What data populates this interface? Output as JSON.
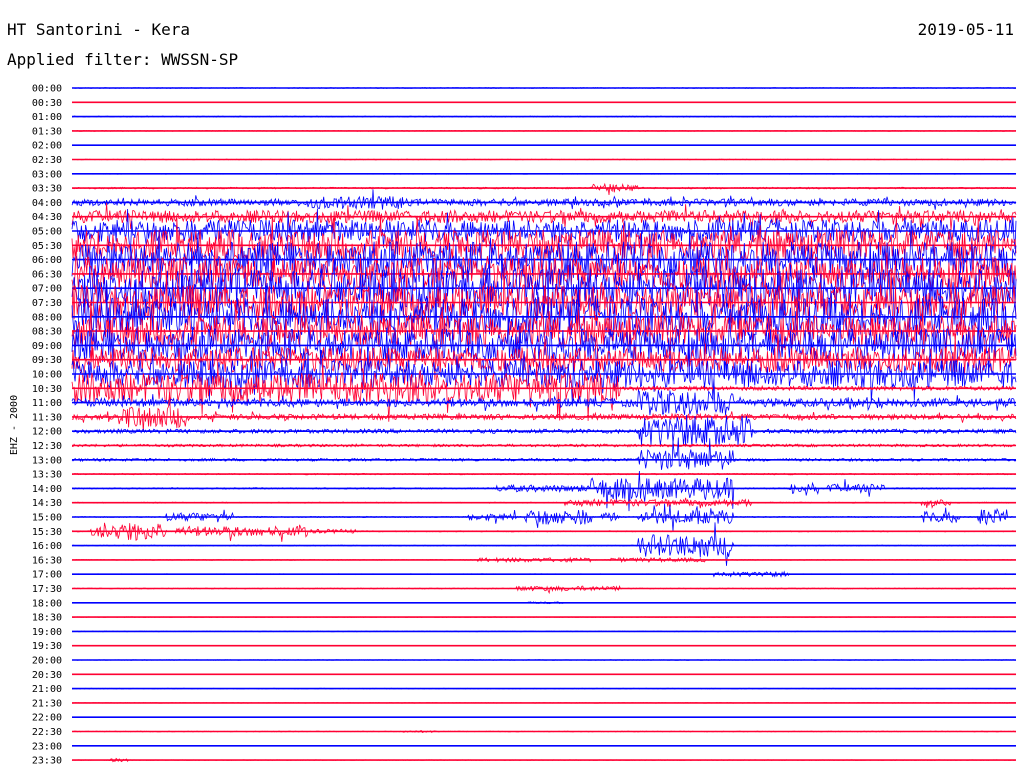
{
  "header": {
    "station": "HT Santorini - Kera",
    "date": "2019-05-11",
    "filter": "Applied filter: WWSSN-SP"
  },
  "chart_data": {
    "type": "line",
    "ylabel": "EHZ - 2000",
    "colors": [
      "#0000ff",
      "#ff0033"
    ],
    "grid": false,
    "legend": "none",
    "x_range_minutes": [
      0,
      30
    ],
    "rows": [
      {
        "label": "00:00",
        "color": "#0000ff",
        "activity": [
          [
            0,
            1.0,
            0.06
          ]
        ]
      },
      {
        "label": "00:30",
        "color": "#ff0033",
        "activity": [
          [
            0,
            1.0,
            0.05
          ]
        ]
      },
      {
        "label": "01:00",
        "color": "#0000ff",
        "activity": [
          [
            0,
            1.0,
            0.07
          ]
        ]
      },
      {
        "label": "01:30",
        "color": "#ff0033",
        "activity": [
          [
            0,
            1.0,
            0.06
          ]
        ]
      },
      {
        "label": "02:00",
        "color": "#0000ff",
        "activity": [
          [
            0,
            1.0,
            0.05
          ]
        ]
      },
      {
        "label": "02:30",
        "color": "#ff0033",
        "activity": [
          [
            0,
            1.0,
            0.04
          ]
        ]
      },
      {
        "label": "03:00",
        "color": "#0000ff",
        "activity": [
          [
            0,
            1.0,
            0.06
          ]
        ]
      },
      {
        "label": "03:30",
        "color": "#ff0033",
        "activity": [
          [
            0,
            1.0,
            0.12
          ],
          [
            0.55,
            0.6,
            0.6
          ]
        ]
      },
      {
        "label": "04:00",
        "color": "#0000ff",
        "activity": [
          [
            0,
            1.0,
            0.5
          ],
          [
            0.25,
            0.35,
            0.9
          ]
        ]
      },
      {
        "label": "04:30",
        "color": "#ff0033",
        "activity": [
          [
            0,
            1.0,
            0.9
          ]
        ]
      },
      {
        "label": "05:00",
        "color": "#0000ff",
        "activity": [
          [
            0,
            1.0,
            1.6
          ]
        ]
      },
      {
        "label": "05:30",
        "color": "#ff0033",
        "activity": [
          [
            0,
            1.0,
            2.2
          ]
        ]
      },
      {
        "label": "06:00",
        "color": "#0000ff",
        "activity": [
          [
            0,
            1.0,
            2.6
          ]
        ]
      },
      {
        "label": "06:30",
        "color": "#ff0033",
        "activity": [
          [
            0,
            1.0,
            2.4
          ]
        ]
      },
      {
        "label": "07:00",
        "color": "#0000ff",
        "activity": [
          [
            0,
            1.0,
            2.8
          ]
        ]
      },
      {
        "label": "07:30",
        "color": "#ff0033",
        "activity": [
          [
            0,
            1.0,
            2.5
          ]
        ]
      },
      {
        "label": "08:00",
        "color": "#0000ff",
        "activity": [
          [
            0,
            1.0,
            2.7
          ]
        ]
      },
      {
        "label": "08:30",
        "color": "#ff0033",
        "activity": [
          [
            0,
            1.0,
            2.3
          ]
        ]
      },
      {
        "label": "09:00",
        "color": "#0000ff",
        "activity": [
          [
            0,
            1.0,
            2.4
          ]
        ]
      },
      {
        "label": "09:30",
        "color": "#ff0033",
        "activity": [
          [
            0,
            1.0,
            1.8
          ]
        ]
      },
      {
        "label": "10:00",
        "color": "#0000ff",
        "activity": [
          [
            0,
            1.0,
            2.0
          ]
        ]
      },
      {
        "label": "10:30",
        "color": "#ff0033",
        "activity": [
          [
            0,
            0.58,
            2.2
          ],
          [
            0.58,
            1.0,
            0.3
          ]
        ]
      },
      {
        "label": "11:00",
        "color": "#0000ff",
        "activity": [
          [
            0,
            1.0,
            0.6
          ],
          [
            0.6,
            0.7,
            1.8
          ],
          [
            0.83,
            0.88,
            0.8
          ]
        ]
      },
      {
        "label": "11:30",
        "color": "#ff0033",
        "activity": [
          [
            0,
            1.0,
            0.4
          ],
          [
            0.05,
            0.12,
            1.6
          ]
        ]
      },
      {
        "label": "12:00",
        "color": "#0000ff",
        "activity": [
          [
            0,
            1.0,
            0.3
          ],
          [
            0.6,
            0.72,
            2.2
          ]
        ]
      },
      {
        "label": "12:30",
        "color": "#ff0033",
        "activity": [
          [
            0,
            1.0,
            0.2
          ]
        ]
      },
      {
        "label": "13:00",
        "color": "#0000ff",
        "activity": [
          [
            0,
            1.0,
            0.2
          ],
          [
            0.6,
            0.7,
            1.5
          ]
        ]
      },
      {
        "label": "13:30",
        "color": "#ff0033",
        "activity": [
          [
            0,
            1.0,
            0.1
          ]
        ]
      },
      {
        "label": "14:00",
        "color": "#0000ff",
        "activity": [
          [
            0,
            1.0,
            0.1
          ],
          [
            0.45,
            0.55,
            0.5
          ],
          [
            0.55,
            0.7,
            1.5
          ],
          [
            0.76,
            0.79,
            0.8
          ],
          [
            0.8,
            0.86,
            0.6
          ]
        ]
      },
      {
        "label": "14:30",
        "color": "#ff0033",
        "activity": [
          [
            0,
            1.0,
            0.08
          ],
          [
            0.52,
            0.72,
            0.5
          ],
          [
            0.9,
            0.93,
            0.4
          ]
        ]
      },
      {
        "label": "15:00",
        "color": "#0000ff",
        "activity": [
          [
            0,
            1.0,
            0.08
          ],
          [
            0.1,
            0.17,
            0.6
          ],
          [
            0.42,
            0.47,
            0.5
          ],
          [
            0.48,
            0.55,
            1.1
          ],
          [
            0.56,
            0.58,
            0.6
          ],
          [
            0.6,
            0.7,
            1.0
          ],
          [
            0.9,
            0.94,
            0.8
          ],
          [
            0.96,
            0.99,
            1.2
          ]
        ]
      },
      {
        "label": "15:30",
        "color": "#ff0033",
        "activity": [
          [
            0,
            1.0,
            0.08
          ],
          [
            0.02,
            0.1,
            1.3
          ],
          [
            0.11,
            0.25,
            0.7
          ],
          [
            0.25,
            0.3,
            0.3
          ]
        ]
      },
      {
        "label": "16:00",
        "color": "#0000ff",
        "activity": [
          [
            0,
            1.0,
            0.06
          ],
          [
            0.6,
            0.7,
            1.6
          ]
        ]
      },
      {
        "label": "16:30",
        "color": "#ff0033",
        "activity": [
          [
            0,
            1.0,
            0.06
          ],
          [
            0.43,
            0.55,
            0.3
          ],
          [
            0.57,
            0.67,
            0.3
          ]
        ]
      },
      {
        "label": "17:00",
        "color": "#0000ff",
        "activity": [
          [
            0,
            1.0,
            0.06
          ],
          [
            0.68,
            0.76,
            0.35
          ]
        ]
      },
      {
        "label": "17:30",
        "color": "#ff0033",
        "activity": [
          [
            0,
            1.0,
            0.06
          ],
          [
            0.47,
            0.58,
            0.35
          ]
        ]
      },
      {
        "label": "18:00",
        "color": "#0000ff",
        "activity": [
          [
            0,
            1.0,
            0.05
          ],
          [
            0.48,
            0.52,
            0.15
          ]
        ]
      },
      {
        "label": "18:30",
        "color": "#ff0033",
        "activity": [
          [
            0,
            1.0,
            0.05
          ]
        ]
      },
      {
        "label": "19:00",
        "color": "#0000ff",
        "activity": [
          [
            0,
            1.0,
            0.05
          ]
        ]
      },
      {
        "label": "19:30",
        "color": "#ff0033",
        "activity": [
          [
            0,
            1.0,
            0.05
          ]
        ]
      },
      {
        "label": "20:00",
        "color": "#0000ff",
        "activity": [
          [
            0,
            1.0,
            0.05
          ]
        ]
      },
      {
        "label": "20:30",
        "color": "#ff0033",
        "activity": [
          [
            0,
            1.0,
            0.05
          ]
        ]
      },
      {
        "label": "21:00",
        "color": "#0000ff",
        "activity": [
          [
            0,
            1.0,
            0.05
          ]
        ]
      },
      {
        "label": "21:30",
        "color": "#ff0033",
        "activity": [
          [
            0,
            1.0,
            0.05
          ]
        ]
      },
      {
        "label": "22:00",
        "color": "#0000ff",
        "activity": [
          [
            0,
            1.0,
            0.05
          ]
        ]
      },
      {
        "label": "22:30",
        "color": "#ff0033",
        "activity": [
          [
            0,
            1.0,
            0.05
          ],
          [
            0.35,
            0.39,
            0.15
          ]
        ]
      },
      {
        "label": "23:00",
        "color": "#0000ff",
        "activity": [
          [
            0,
            1.0,
            0.05
          ]
        ]
      },
      {
        "label": "23:30",
        "color": "#ff0033",
        "activity": [
          [
            0,
            1.0,
            0.05
          ],
          [
            0.04,
            0.06,
            0.25
          ]
        ]
      }
    ]
  }
}
